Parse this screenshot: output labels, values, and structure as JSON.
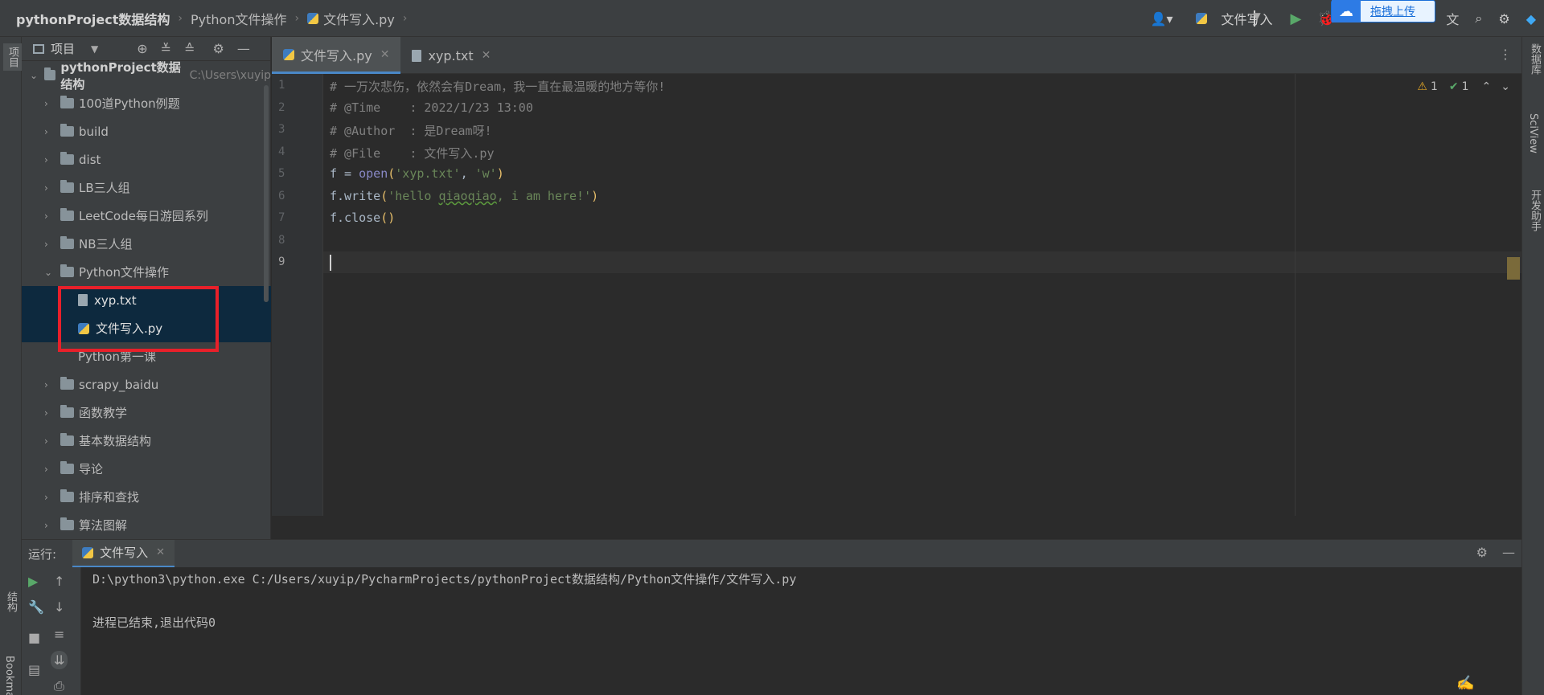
{
  "navbar": {
    "crumbs": [
      "pythonProject数据结构",
      "Python文件操作",
      "文件写入.py"
    ],
    "run_config": "文件写入",
    "upload_label": "拖拽上传"
  },
  "left_stripe": {
    "project_tab": "项目",
    "structure_tab": "结构",
    "bookmarks_tab": "Bookmarks"
  },
  "project_panel": {
    "title": "项目",
    "root": {
      "name": "pythonProject数据结构",
      "path": "C:\\Users\\xuyip"
    },
    "items": [
      {
        "label": "100道Python例题"
      },
      {
        "label": "build"
      },
      {
        "label": "dist"
      },
      {
        "label": "LB三人组"
      },
      {
        "label": "LeetCode每日游园系列"
      },
      {
        "label": "NB三人组"
      },
      {
        "label": "Python文件操作"
      },
      {
        "label": "xyp.txt"
      },
      {
        "label": "文件写入.py"
      },
      {
        "label": "Python第一课"
      },
      {
        "label": "scrapy_baidu"
      },
      {
        "label": "函数教学"
      },
      {
        "label": "基本数据结构"
      },
      {
        "label": "导论"
      },
      {
        "label": "排序和查找"
      },
      {
        "label": "算法图解"
      }
    ]
  },
  "editor": {
    "tabs": [
      {
        "label": "文件写入.py",
        "active": true
      },
      {
        "label": "xyp.txt",
        "active": false
      }
    ],
    "line_numbers": [
      "1",
      "2",
      "3",
      "4",
      "5",
      "6",
      "7",
      "8",
      "9"
    ],
    "inspections": {
      "warnings": "1",
      "ok": "1"
    },
    "code": {
      "l1": "# 一万次悲伤，依然会有Dream，我一直在最温暖的地方等你!",
      "l2": "# @Time    : 2022/1/23 13:00",
      "l3": "# @Author  : 是Dream呀!",
      "l4": "# @File    : 文件写入.py",
      "l5_a": "f = ",
      "l5_b": "open",
      "l5_c": "(",
      "l5_d": "'xyp.txt'",
      "l5_e": ", ",
      "l5_f": "'w'",
      "l5_g": ")",
      "l6_a": "f.write",
      "l6_b": "(",
      "l6_c": "'hello ",
      "l6_d": "qiaoqiao",
      "l6_e": ", i am here!'",
      "l6_f": ")",
      "l7_a": "f.close",
      "l7_b": "()"
    }
  },
  "right_stripe": {
    "database_tab": "数据库",
    "sciview_tab": "SciView",
    "dev_tab": "开发助手"
  },
  "run_panel": {
    "label": "运行:",
    "tab": "文件写入",
    "console": [
      "D:\\python3\\python.exe C:/Users/xuyip/PycharmProjects/pythonProject数据结构/Python文件操作/文件写入.py",
      "",
      "进程已结束,退出代码0"
    ]
  },
  "colors": {
    "accent": "#4a88c7",
    "highlight_box": "#e8202a",
    "run_green": "#59a869"
  }
}
